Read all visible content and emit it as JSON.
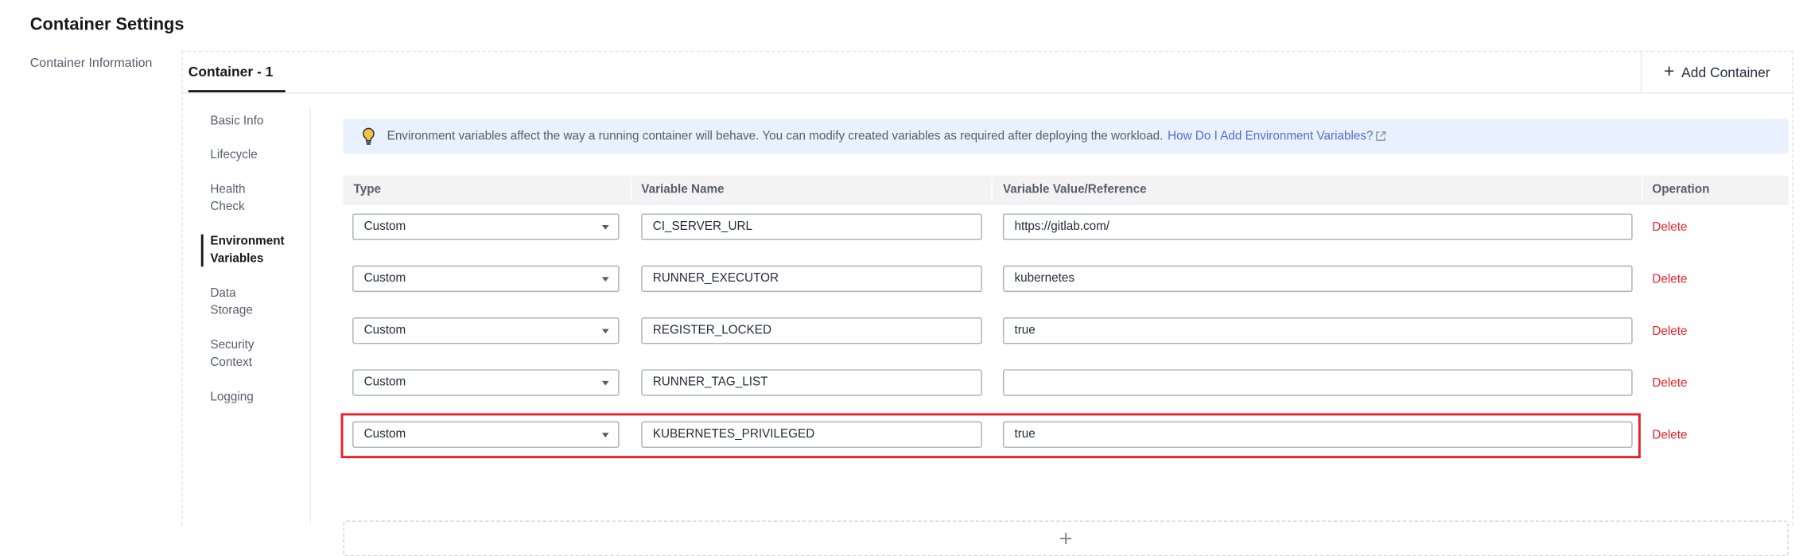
{
  "page": {
    "title": "Container Settings",
    "left_nav": {
      "item": "Container Information"
    }
  },
  "container_tabs": {
    "active_tab": "Container - 1",
    "add_label": "Add Container"
  },
  "subnav": {
    "items": [
      {
        "label": "Basic Info"
      },
      {
        "label": "Lifecycle"
      },
      {
        "label": "Health Check"
      },
      {
        "label": "Environment Variables"
      },
      {
        "label": "Data Storage"
      },
      {
        "label": "Security Context"
      },
      {
        "label": "Logging"
      }
    ],
    "active_index": 3
  },
  "tip": {
    "text": "Environment variables affect the way a running container will behave. You can modify created variables as required after deploying the workload.",
    "link": "How Do I Add Environment Variables?"
  },
  "table": {
    "headers": {
      "type": "Type",
      "name": "Variable Name",
      "value": "Variable Value/Reference",
      "operation": "Operation"
    },
    "rows": [
      {
        "type": "Custom",
        "name": "CI_SERVER_URL",
        "value": "https://gitlab.com/",
        "action": "Delete",
        "highlighted": false
      },
      {
        "type": "Custom",
        "name": "RUNNER_EXECUTOR",
        "value": "kubernetes",
        "action": "Delete",
        "highlighted": false
      },
      {
        "type": "Custom",
        "name": "REGISTER_LOCKED",
        "value": "true",
        "action": "Delete",
        "highlighted": false
      },
      {
        "type": "Custom",
        "name": "RUNNER_TAG_LIST",
        "value": "",
        "action": "Delete",
        "highlighted": false
      },
      {
        "type": "Custom",
        "name": "KUBERNETES_PRIVILEGED",
        "value": "true",
        "action": "Delete",
        "highlighted": true
      }
    ],
    "add_icon": "plus-icon"
  },
  "colors": {
    "danger": "#e6212a",
    "link": "#526ecc",
    "tip_bg": "#e8f1fd",
    "text": "#252b3a"
  }
}
